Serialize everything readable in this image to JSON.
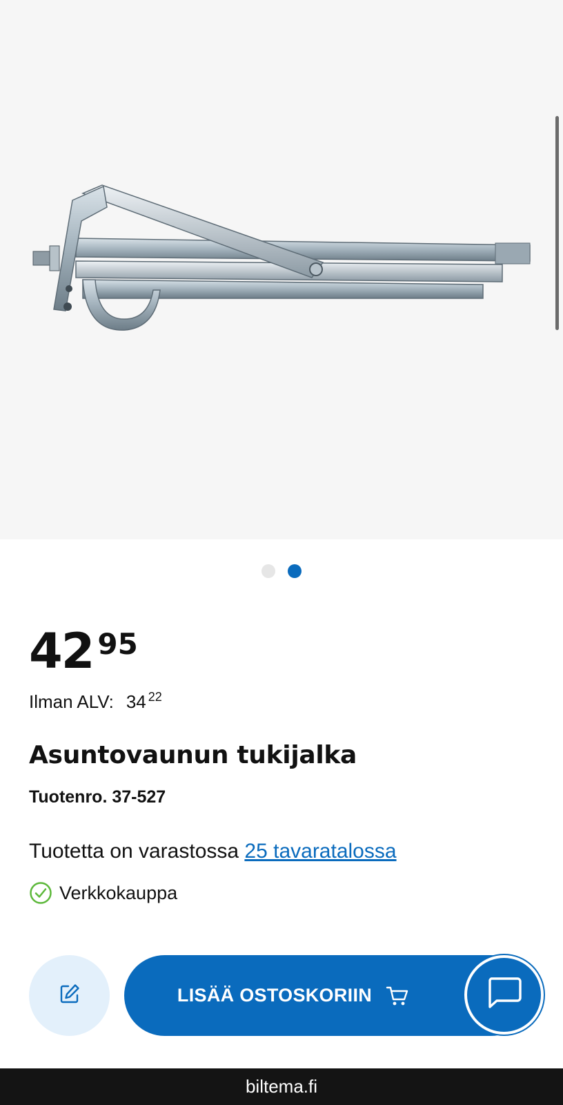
{
  "gallery": {
    "image_alt": "product-photo-support-leg",
    "current_slide": 2,
    "slide_count": 2
  },
  "product": {
    "price_int": "42",
    "price_dec": "95",
    "vat_label": "Ilman ALV:",
    "vat_int": "34",
    "vat_dec": "22",
    "title": "Asuntovaunun tukijalka",
    "sku": "Tuotenro. 37-527"
  },
  "stock": {
    "text": "Tuotetta on varastossa ",
    "link": "25 tavaratalossa",
    "web_label": "Verkkokauppa"
  },
  "actions": {
    "add_to_cart": "LISÄÄ OSTOSKORIIN"
  },
  "browser": {
    "url": "biltema.fi"
  },
  "colors": {
    "brand_blue": "#0a6bbd",
    "light_blue": "#e3f0fb",
    "check_green": "#5cb83a"
  },
  "icons": [
    "edit-icon",
    "cart-icon",
    "chat-icon",
    "check-circle-icon"
  ]
}
